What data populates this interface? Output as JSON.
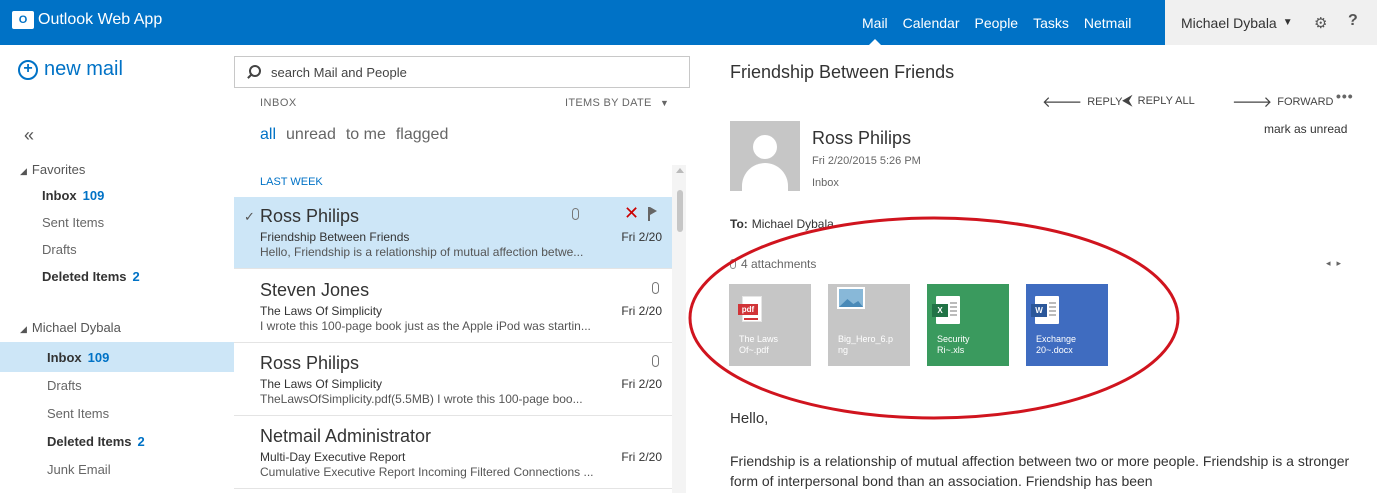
{
  "app": {
    "title": "Outlook Web App",
    "logo_text": "O"
  },
  "nav": [
    "Mail",
    "Calendar",
    "People",
    "Tasks",
    "Netmail"
  ],
  "user": {
    "name": "Michael Dybala"
  },
  "left": {
    "new_mail": "new mail",
    "collapse": "«",
    "favorites_label": "Favorites",
    "favorites": [
      {
        "label": "Inbox",
        "count": "109"
      },
      {
        "label": "Sent Items",
        "count": ""
      },
      {
        "label": "Drafts",
        "count": ""
      },
      {
        "label": "Deleted Items",
        "count": "2"
      }
    ],
    "account_label": "Michael Dybala",
    "account_folders": [
      {
        "label": "Inbox",
        "count": "109"
      },
      {
        "label": "Drafts",
        "count": ""
      },
      {
        "label": "Sent Items",
        "count": ""
      },
      {
        "label": "Deleted Items",
        "count": "2"
      },
      {
        "label": "Junk Email",
        "count": ""
      }
    ]
  },
  "list": {
    "search_placeholder": "search Mail and People",
    "folder_label": "INBOX",
    "sort_label": "ITEMS BY DATE",
    "filters": [
      "all",
      "unread",
      "to me",
      "flagged"
    ],
    "section": "LAST WEEK",
    "messages": [
      {
        "from": "Ross Philips",
        "subject": "Friendship Between Friends",
        "date": "Fri 2/20",
        "preview": "Hello,    Friendship is a relationship of mutual affection betwe..."
      },
      {
        "from": "Steven Jones",
        "subject": "The Laws Of Simplicity",
        "date": "Fri 2/20",
        "preview": "I wrote this 100-page book just as the Apple iPod was startin..."
      },
      {
        "from": "Ross Philips",
        "subject": "The Laws Of Simplicity",
        "date": "Fri 2/20",
        "preview": "TheLawsOfSimplicity.pdf(5.5MB)    I wrote this 100-page boo..."
      },
      {
        "from": "Netmail Administrator",
        "subject": "Multi-Day Executive Report",
        "date": "Fri 2/20",
        "preview": "Cumulative Executive Report Incoming Filtered Connections ..."
      }
    ]
  },
  "reading": {
    "subject": "Friendship Between Friends",
    "actions": {
      "reply": "REPLY",
      "reply_all": "REPLY ALL",
      "forward": "FORWARD",
      "more": "•••"
    },
    "mark_unread": "mark as unread",
    "sender": "Ross Philips",
    "sent": "Fri 2/20/2015 5:26 PM",
    "folder": "Inbox",
    "to_label": "To:",
    "to": "Michael Dybala",
    "attachments_label": "4 attachments",
    "attachments": [
      {
        "name1": "The Laws",
        "name2": "Of~.pdf",
        "tag": "pdf",
        "color": "#c6c6c6"
      },
      {
        "name1": "Big_Hero_6.p",
        "name2": "ng",
        "tag": "",
        "color": "#c6c6c6"
      },
      {
        "name1": "Security",
        "name2": "Ri~.xls",
        "tag": "X",
        "color": "#3a9a5e"
      },
      {
        "name1": "Exchange",
        "name2": "20~.docx",
        "tag": "W",
        "color": "#3f6cc0"
      }
    ],
    "greeting": "Hello,",
    "body": "Friendship is a relationship of mutual affection between two or more people. Friendship is a stronger form of interpersonal bond than an association. Friendship has been"
  },
  "colors": {
    "brand": "#0072c6",
    "selected": "#cde6f7",
    "annotation": "#d0141e"
  }
}
